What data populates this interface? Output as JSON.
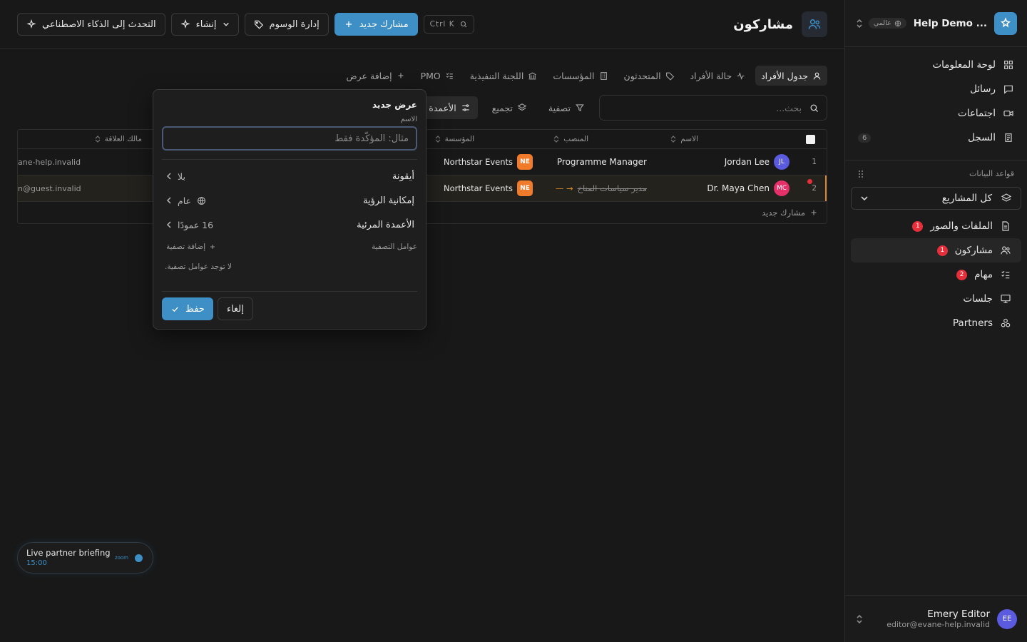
{
  "sidebar": {
    "workspace_name": "... Help Demo",
    "workspace_badge": "عالمي",
    "nav": [
      {
        "label": "لوحة المعلومات",
        "icon": "grid-icon"
      },
      {
        "label": "رسائل",
        "icon": "message-icon"
      },
      {
        "label": "اجتماعات",
        "icon": "video-icon"
      },
      {
        "label": "السجل",
        "icon": "log-icon",
        "count": "6"
      }
    ],
    "databases_title": "قواعد البيانات",
    "project_selector": "كل المشاريع",
    "databases": [
      {
        "label": "الملفات والصور",
        "icon": "file-icon",
        "badge": "1"
      },
      {
        "label": "مشاركون",
        "icon": "users-icon",
        "badge": "1",
        "active": true
      },
      {
        "label": "مهام",
        "icon": "tasks-icon",
        "badge": "2"
      },
      {
        "label": "جلسات",
        "icon": "presentation-icon"
      },
      {
        "label": "Partners",
        "icon": "partners-icon"
      }
    ],
    "user": {
      "initials": "EE",
      "name": "Emery Editor",
      "email": "editor@evane-help.invalid"
    }
  },
  "header": {
    "title": "مشاركون",
    "shortcut": "Ctrl K",
    "new_participant": "مشارك جديد",
    "manage_tags": "إدارة الوسوم",
    "create": "إنشاء",
    "ai_chat": "التحدث إلى الذكاء الاصطناعي"
  },
  "tabs": [
    {
      "label": "جدول الأفراد",
      "active": true
    },
    {
      "label": "حالة الأفراد"
    },
    {
      "label": "المتحدثون"
    },
    {
      "label": "المؤسسات"
    },
    {
      "label": "اللجنة التنفيذية"
    },
    {
      "label": "PMO"
    },
    {
      "label": "إضافة عرض"
    }
  ],
  "toolbar": {
    "search_placeholder": "بحث...",
    "filter": "تصفية",
    "group": "تجميع",
    "columns": "الأعمدة"
  },
  "table": {
    "headers": {
      "name": "الاسم",
      "position": "المنصب",
      "organization": "المؤسسة",
      "owner": "مالك العلاقة"
    },
    "rows": [
      {
        "num": "1",
        "initials": "JL",
        "avatar_color": "#5b5bdf",
        "name": "Jordan Lee",
        "position": "Programme Manager",
        "org_initials": "NE",
        "organization": "Northstar Events",
        "owner": "ane-help.invalid"
      },
      {
        "num": "2",
        "initials": "MC",
        "avatar_color": "#e5306a",
        "name": "Dr. Maya Chen",
        "position_old": "مدير سياسات المناخ",
        "position_arrow": "→ —",
        "org_initials": "NE",
        "organization": "Northstar Events",
        "owner": "n@guest.invalid",
        "selected": true
      }
    ],
    "add_row": "مشارك جديد"
  },
  "popover": {
    "title": "عرض جديد",
    "name_label": "الاسم",
    "name_placeholder": "مثال: المؤكّدة فقط",
    "icon_label": "أيقونة",
    "icon_value": "بلا",
    "visibility_label": "إمكانية الرؤية",
    "visibility_value": "عام",
    "columns_label": "الأعمدة المرئية",
    "columns_value": "16 عمودًا",
    "filters_label": "عوامل التصفية",
    "add_filter": "إضافة تصفية",
    "no_filters": "لا توجد عوامل تصفية.",
    "cancel": "إلغاء",
    "save": "حفظ"
  },
  "briefing": {
    "title": "Live partner briefing",
    "time": "15:00",
    "brand": "zoom"
  }
}
